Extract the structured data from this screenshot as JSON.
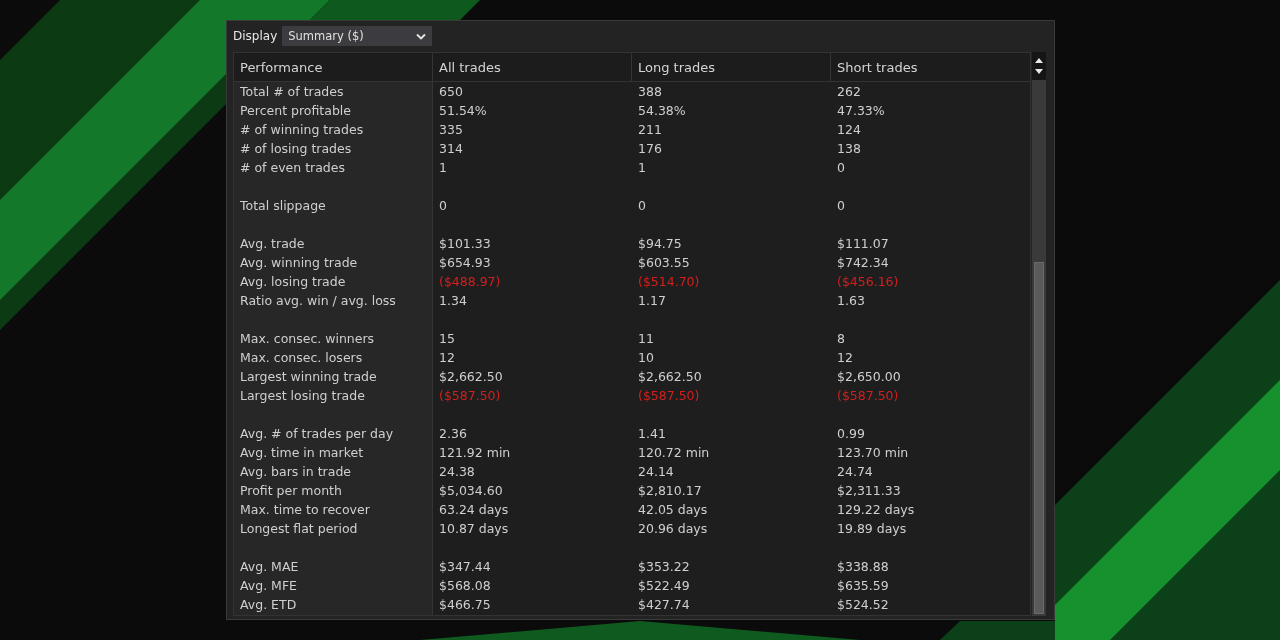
{
  "display": {
    "label": "Display",
    "value": "Summary ($)"
  },
  "table": {
    "columns": [
      "Performance",
      "All trades",
      "Long trades",
      "Short trades"
    ],
    "groups": [
      {
        "rows": [
          {
            "label": "Total # of trades",
            "values": [
              "650",
              "388",
              "262"
            ],
            "negative": false
          },
          {
            "label": "Percent profitable",
            "values": [
              "51.54%",
              "54.38%",
              "47.33%"
            ],
            "negative": false
          },
          {
            "label": "# of winning trades",
            "values": [
              "335",
              "211",
              "124"
            ],
            "negative": false
          },
          {
            "label": "# of losing trades",
            "values": [
              "314",
              "176",
              "138"
            ],
            "negative": false
          },
          {
            "label": "# of even trades",
            "values": [
              "1",
              "1",
              "0"
            ],
            "negative": false
          }
        ]
      },
      {
        "rows": [
          {
            "label": "Total slippage",
            "values": [
              "0",
              "0",
              "0"
            ],
            "negative": false
          }
        ]
      },
      {
        "rows": [
          {
            "label": "Avg. trade",
            "values": [
              "$101.33",
              "$94.75",
              "$111.07"
            ],
            "negative": false
          },
          {
            "label": "Avg. winning trade",
            "values": [
              "$654.93",
              "$603.55",
              "$742.34"
            ],
            "negative": false
          },
          {
            "label": "Avg. losing trade",
            "values": [
              "($488.97)",
              "($514.70)",
              "($456.16)"
            ],
            "negative": true
          },
          {
            "label": "Ratio avg. win / avg. loss",
            "values": [
              "1.34",
              "1.17",
              "1.63"
            ],
            "negative": false
          }
        ]
      },
      {
        "rows": [
          {
            "label": "Max. consec. winners",
            "values": [
              "15",
              "11",
              "8"
            ],
            "negative": false
          },
          {
            "label": "Max. consec. losers",
            "values": [
              "12",
              "10",
              "12"
            ],
            "negative": false
          },
          {
            "label": "Largest winning trade",
            "values": [
              "$2,662.50",
              "$2,662.50",
              "$2,650.00"
            ],
            "negative": false
          },
          {
            "label": "Largest losing trade",
            "values": [
              "($587.50)",
              "($587.50)",
              "($587.50)"
            ],
            "negative": true
          }
        ]
      },
      {
        "rows": [
          {
            "label": "Avg. # of trades per day",
            "values": [
              "2.36",
              "1.41",
              "0.99"
            ],
            "negative": false
          },
          {
            "label": "Avg. time in market",
            "values": [
              "121.92 min",
              "120.72 min",
              "123.70 min"
            ],
            "negative": false
          },
          {
            "label": "Avg. bars in trade",
            "values": [
              "24.38",
              "24.14",
              "24.74"
            ],
            "negative": false
          },
          {
            "label": "Profit per month",
            "values": [
              "$5,034.60",
              "$2,810.17",
              "$2,311.33"
            ],
            "negative": false
          },
          {
            "label": "Max. time to recover",
            "values": [
              "63.24 days",
              "42.05 days",
              "129.22 days"
            ],
            "negative": false
          },
          {
            "label": "Longest flat period",
            "values": [
              "10.87 days",
              "20.96 days",
              "19.89 days"
            ],
            "negative": false
          }
        ]
      },
      {
        "rows": [
          {
            "label": "Avg. MAE",
            "values": [
              "$347.44",
              "$353.22",
              "$338.88"
            ],
            "negative": false
          },
          {
            "label": "Avg. MFE",
            "values": [
              "$568.08",
              "$522.49",
              "$635.59"
            ],
            "negative": false
          },
          {
            "label": "Avg. ETD",
            "values": [
              "$466.75",
              "$427.74",
              "$524.52"
            ],
            "negative": false
          }
        ]
      }
    ]
  }
}
